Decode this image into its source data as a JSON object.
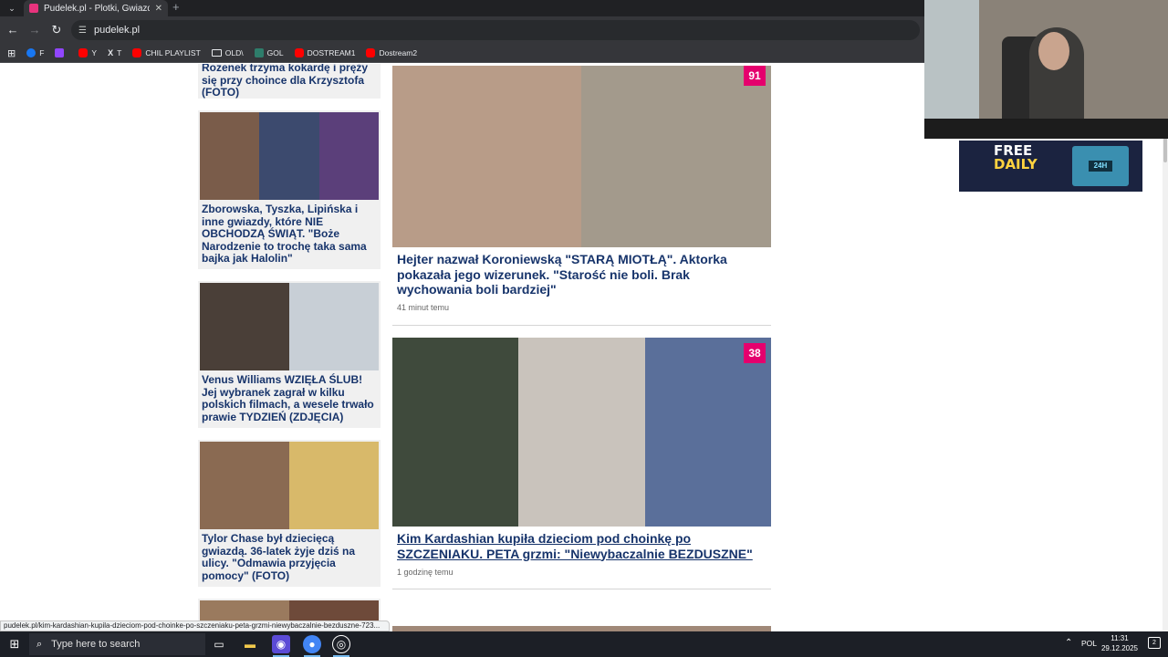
{
  "browser": {
    "tab_title": "Pudelek.pl - Plotki, Gwiazdy, Se",
    "tab_close": "✕",
    "new_tab": "+",
    "url": "pudelek.pl",
    "bookmarks": [
      {
        "label": "F",
        "icon": "facebook-icon",
        "color": "#1877f2"
      },
      {
        "label": "",
        "icon": "twitch-icon",
        "color": "#9146ff"
      },
      {
        "label": "Y",
        "icon": "youtube-icon",
        "color": "#ff0000"
      },
      {
        "label": "T",
        "icon": "x-icon",
        "color": "#ffffff"
      },
      {
        "label": "CHIL PLAYLIST",
        "icon": "youtube-icon",
        "color": "#ff0000"
      },
      {
        "label": "OLD\\",
        "icon": "folder-icon",
        "color": ""
      },
      {
        "label": "GOL",
        "icon": "gol-icon",
        "color": "#2e7d6b"
      },
      {
        "label": "DOSTREAM1",
        "icon": "youtube-icon",
        "color": "#ff0000"
      },
      {
        "label": "Dostream2",
        "icon": "youtube-icon",
        "color": "#ff0000"
      }
    ]
  },
  "sidebar": {
    "partial_title": "Rozenek trzyma kokardę i pręży się przy choince dla Krzysztofa (FOTO)",
    "cards": [
      {
        "title": "Zborowska, Tyszka, Lipińska i inne gwiazdy, które NIE OBCHODZĄ ŚWIĄT. \"Boże Narodzenie to trochę taka sama bajka jak Halolin\""
      },
      {
        "title": "Venus Williams WZIĘŁA ŚLUB! Jej wybranek zagrał w kilku polskich filmach, a wesele trwało prawie TYDZIEŃ (ZDJĘCIA)"
      },
      {
        "title": "Tylor Chase był dziecięcą gwiazdą. 36-latek żyje dziś na ulicy. \"Odmawia przyjęcia pomocy\" (FOTO)"
      }
    ]
  },
  "main": {
    "articles": [
      {
        "badge": "91",
        "title": "Hejter nazwał Koroniewską \"STARĄ MIOTŁĄ\". Aktorka pokazała jego wizerunek. \"Starość nie boli. Brak wychowania boli bardziej\"",
        "time": "41 minut temu"
      },
      {
        "badge": "38",
        "title": "Kim Kardashian kupiła dzieciom pod choinkę po SZCZENIAKU. PETA grzmi: \"Niewybaczalnie BEZDUSZNE\"",
        "time": "1 godzinę temu"
      }
    ]
  },
  "status_url": "pudelek.pl/kim-kardashian-kupila-dzieciom-pod-choinke-po-szczeniaku-peta-grzmi-niewybaczalnie-bezduszne-723...",
  "ad": {
    "line1": "FREE",
    "line2": "DAILY",
    "chest_label": "24H"
  },
  "taskbar": {
    "search_placeholder": "Type here to search",
    "language": "POL",
    "time": "11:31",
    "date": "29.12.2025",
    "notification_count": "2"
  },
  "colors": {
    "headline": "#17346b",
    "badge": "#e5006d",
    "chrome": "#35363a",
    "taskbar": "#1c1f26"
  }
}
